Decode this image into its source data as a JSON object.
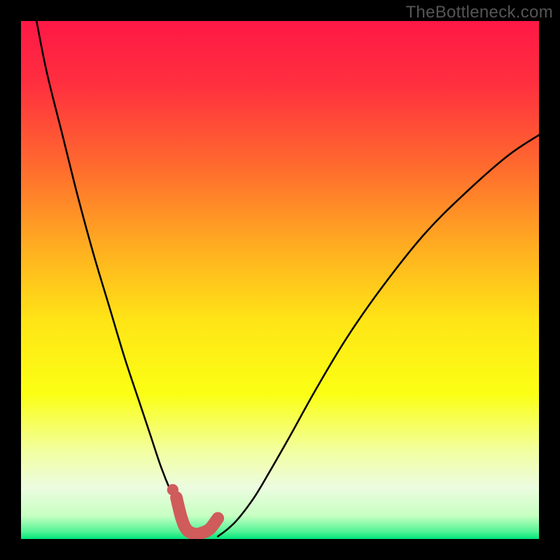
{
  "watermark": "TheBottleneck.com",
  "chart_data": {
    "type": "line",
    "title": "",
    "xlabel": "",
    "ylabel": "",
    "xlim": [
      0,
      100
    ],
    "ylim": [
      0,
      100
    ],
    "gradient_stops": [
      {
        "offset": 0.0,
        "color": "#ff1846"
      },
      {
        "offset": 0.12,
        "color": "#ff2f3f"
      },
      {
        "offset": 0.28,
        "color": "#ff6a2e"
      },
      {
        "offset": 0.45,
        "color": "#ffb31f"
      },
      {
        "offset": 0.58,
        "color": "#ffe516"
      },
      {
        "offset": 0.72,
        "color": "#fbff14"
      },
      {
        "offset": 0.83,
        "color": "#f2ffa0"
      },
      {
        "offset": 0.9,
        "color": "#ecfce0"
      },
      {
        "offset": 0.955,
        "color": "#c7ffc2"
      },
      {
        "offset": 0.985,
        "color": "#56f597"
      },
      {
        "offset": 1.0,
        "color": "#00e47a"
      }
    ],
    "series": [
      {
        "name": "left-curve",
        "x": [
          3,
          5,
          8,
          11,
          14,
          17,
          20,
          23,
          25,
          27,
          29,
          30.5,
          32,
          33,
          34,
          35
        ],
        "y": [
          100,
          90,
          78,
          66,
          55,
          45,
          35,
          26,
          20,
          14,
          9,
          6,
          3.5,
          2,
          1,
          0.5
        ]
      },
      {
        "name": "right-curve",
        "x": [
          38,
          40,
          42,
          45,
          48,
          52,
          57,
          63,
          70,
          78,
          86,
          94,
          100
        ],
        "y": [
          0.5,
          2,
          4,
          8,
          13,
          20,
          29,
          39,
          49,
          59,
          67,
          74,
          78
        ]
      },
      {
        "name": "highlight-segment",
        "color": "#cf5b5b",
        "x": [
          30,
          31,
          32,
          33.5,
          35,
          36.5,
          38
        ],
        "y": [
          8,
          4,
          1.8,
          1.0,
          1.2,
          2.0,
          4
        ]
      }
    ],
    "markers": [
      {
        "name": "highlight-dot",
        "x": 29.3,
        "y": 9.5,
        "r": 1.1,
        "color": "#cf5b5b"
      }
    ]
  }
}
